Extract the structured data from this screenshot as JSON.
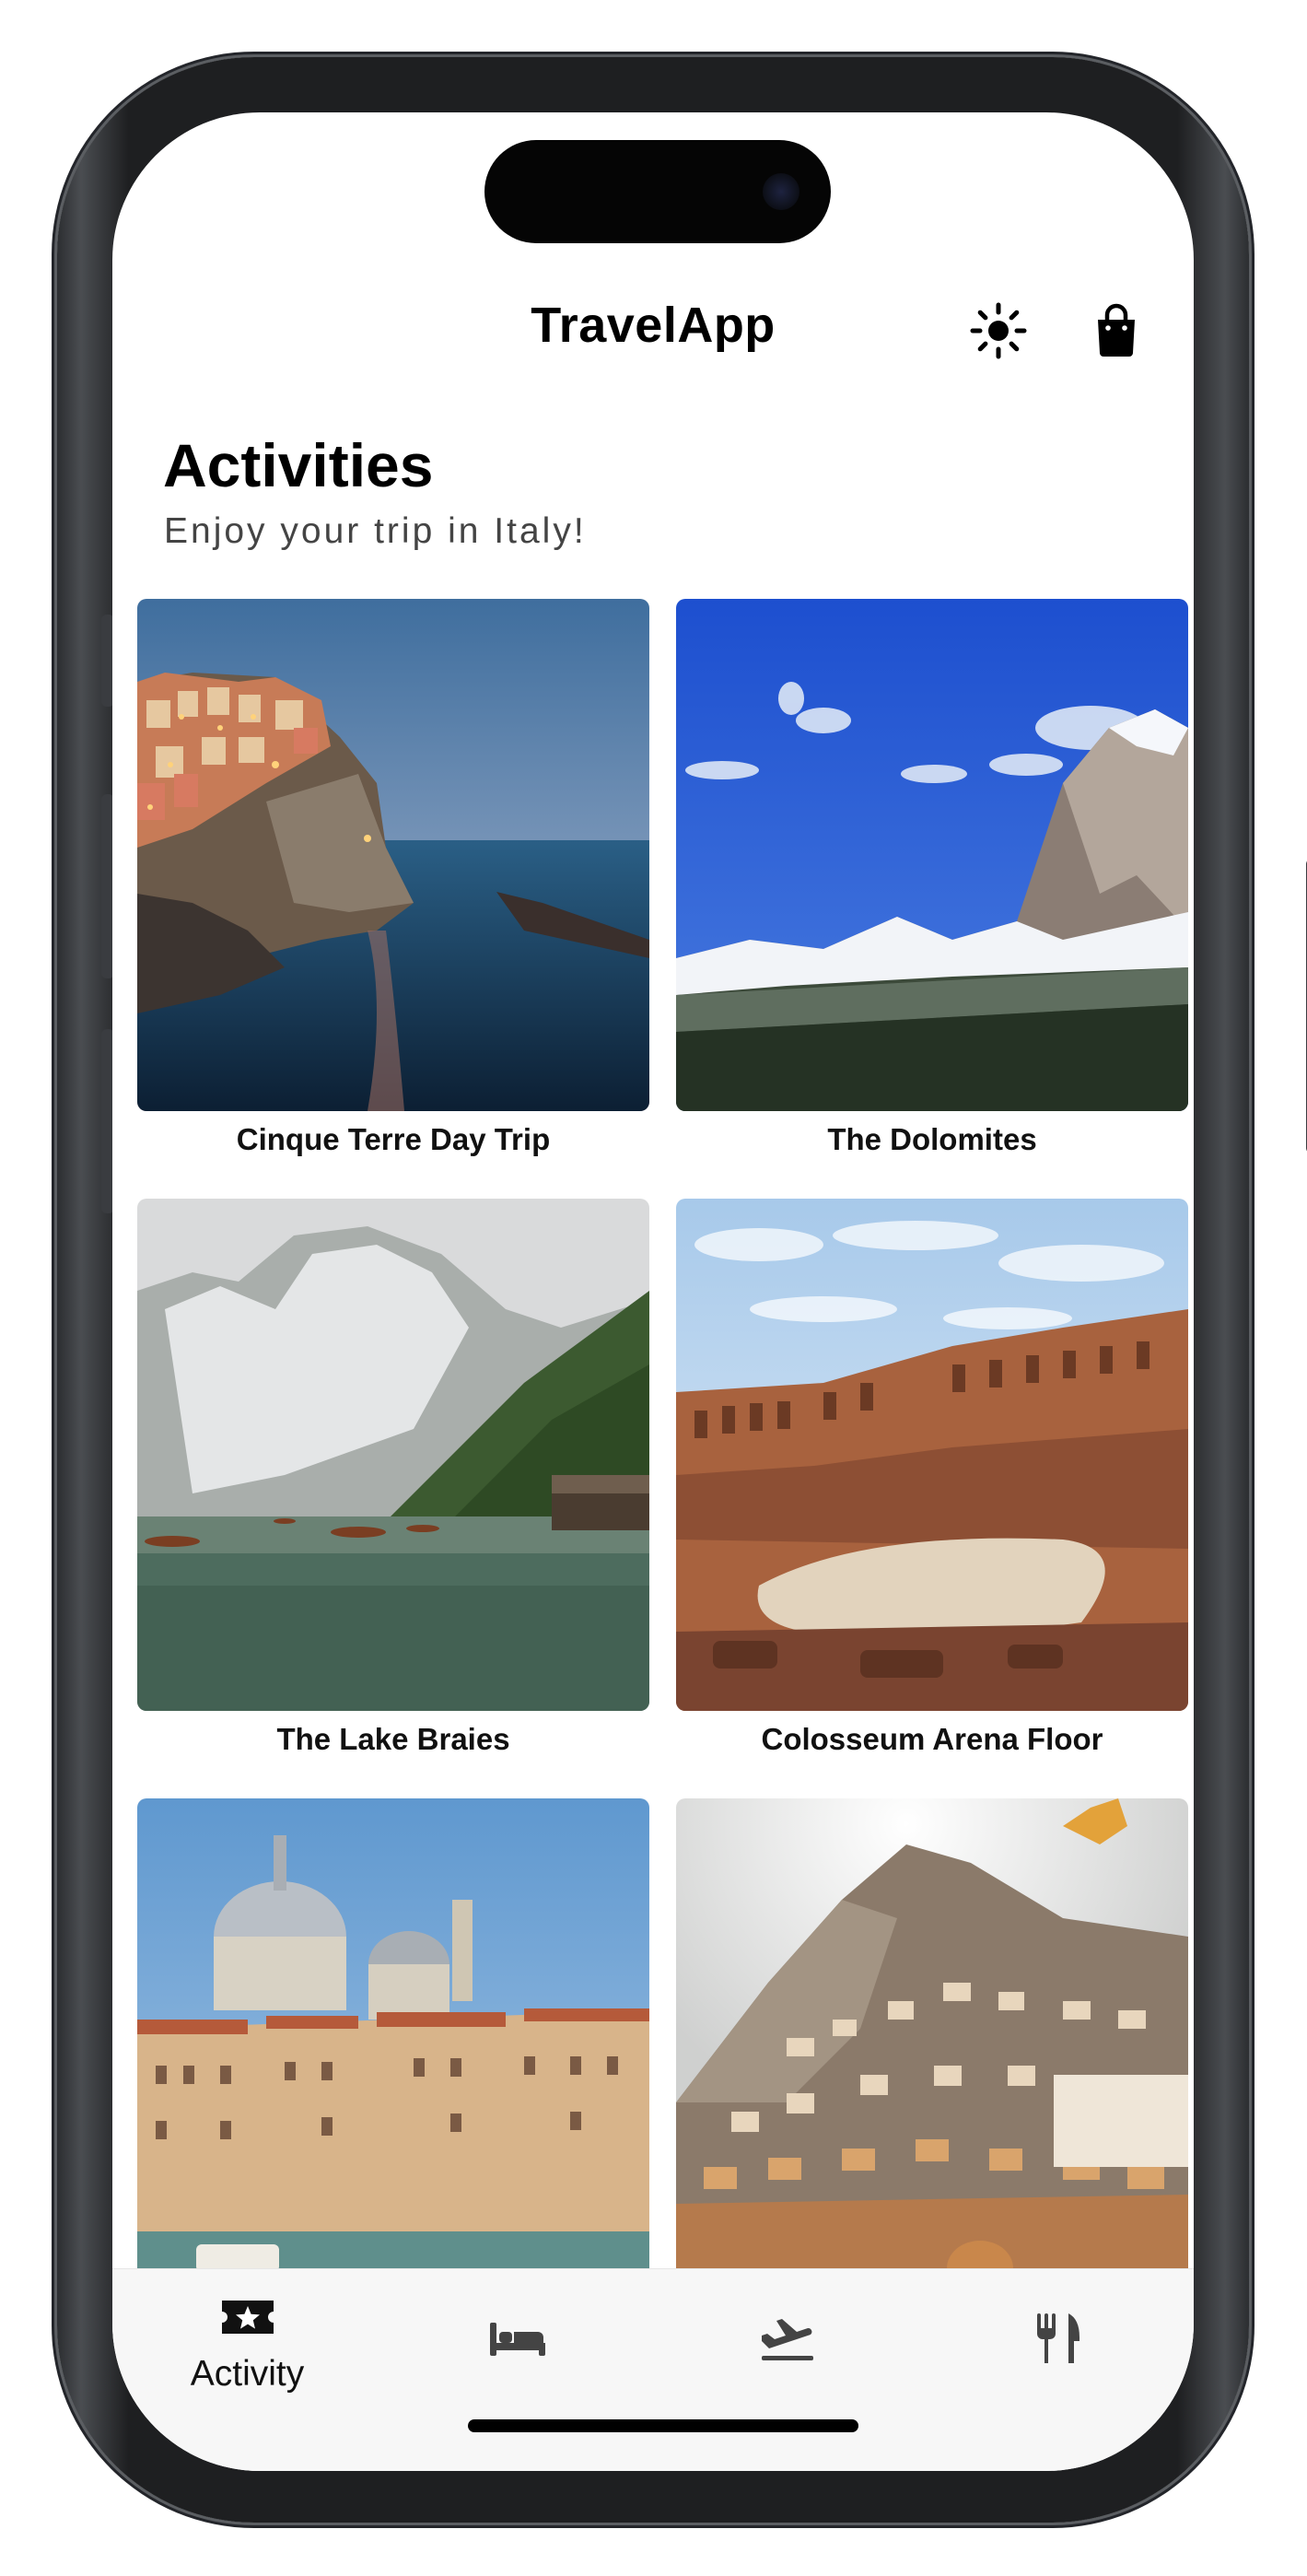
{
  "nav": {
    "title": "TravelApp",
    "theme_icon": "sun-icon",
    "cart_icon": "shopping-bag-icon"
  },
  "header": {
    "title": "Activities",
    "subtitle": "Enjoy your trip in Italy!"
  },
  "activities": [
    {
      "label": "Cinque Terre Day Trip",
      "image": "cliffside-village-at-dusk"
    },
    {
      "label": "The Dolomites",
      "image": "snowy-mountain-peak"
    },
    {
      "label": "The Lake Braies",
      "image": "alpine-lake-with-boats"
    },
    {
      "label": "Colosseum Arena Floor",
      "image": "colosseum-interior"
    },
    {
      "label": "",
      "image": "venice-grand-canal"
    },
    {
      "label": "",
      "image": "positano-hillside"
    }
  ],
  "tabbar": {
    "items": [
      {
        "label": "Activity",
        "icon": "ticket-star-icon",
        "selected": true
      },
      {
        "label": "",
        "icon": "bed-icon",
        "selected": false
      },
      {
        "label": "",
        "icon": "airplane-departure-icon",
        "selected": false
      },
      {
        "label": "",
        "icon": "fork-knife-icon",
        "selected": false
      }
    ]
  },
  "colors": {
    "text": "#000000",
    "subtitle": "#444444",
    "tabbar_bg": "#f7f7f7",
    "icon": "#222222"
  }
}
